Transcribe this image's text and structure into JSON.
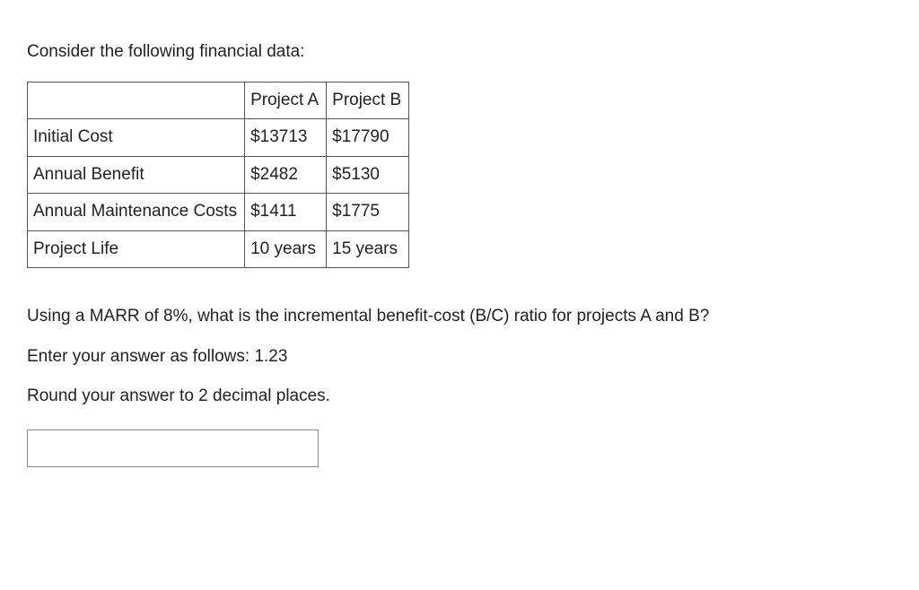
{
  "intro": "Consider the following financial data:",
  "table": {
    "corner": "",
    "headers": [
      "Project A",
      "Project B"
    ],
    "rows": [
      {
        "label": "Initial Cost",
        "a": "$13713",
        "b": "$17790"
      },
      {
        "label": "Annual Benefit",
        "a": "$2482",
        "b": "$5130"
      },
      {
        "label": "Annual Maintenance Costs",
        "a": "$1411",
        "b": "$1775"
      },
      {
        "label": "Project Life",
        "a": "10 years",
        "b": "15 years"
      }
    ]
  },
  "question": "Using a MARR of 8%, what is the incremental benefit-cost (B/C) ratio for projects A and B?",
  "instruction1": "Enter your answer as follows: 1.23",
  "instruction2": "Round your answer to 2 decimal places.",
  "answer_value": ""
}
